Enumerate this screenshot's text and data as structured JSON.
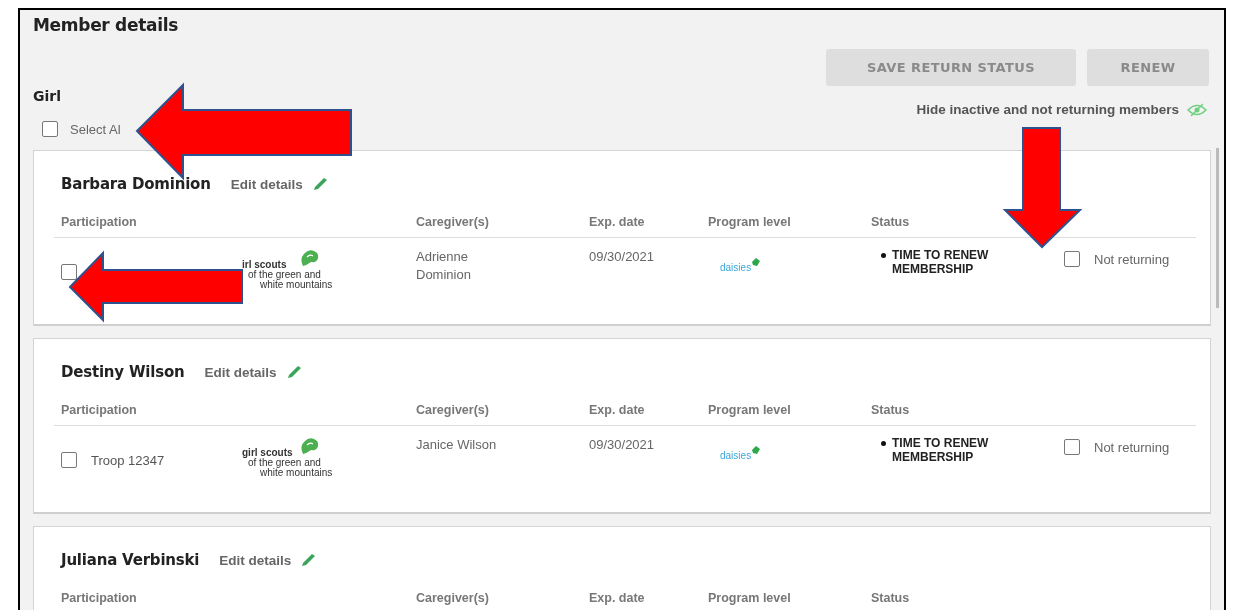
{
  "title": "Member details",
  "buttons": [
    {
      "label": "SAVE RETURN STATUS",
      "disabled": true
    },
    {
      "label": "RENEW",
      "disabled": true
    }
  ],
  "section": "Girl",
  "select_all": {
    "label": "Select Al",
    "checked": false
  },
  "hide_toggle": {
    "label": "Hide inactive and not returning members"
  },
  "members": [
    {
      "name": "Barbara Dominion",
      "edit_label": "Edit details",
      "columns": [
        "Participation",
        "Caregiver(s)",
        "Exp. date",
        "Program level",
        "Status"
      ],
      "row": {
        "troop_checked": false,
        "org_logo": [
          "irl scouts",
          "of the green and",
          "white mountains"
        ],
        "caregiver": "Adrienne Dominion",
        "exp_date": "09/30/2021",
        "program_logo": "daisies",
        "status": "TIME TO RENEW MEMBERSHIP",
        "not_returning": {
          "label": "Not returning",
          "checked": false
        }
      }
    },
    {
      "name": "Destiny Wilson",
      "edit_label": "Edit details",
      "columns": [
        "Participation",
        "Caregiver(s)",
        "Exp. date",
        "Program level",
        "Status"
      ],
      "row": {
        "troop_checked": false,
        "troop": "Troop 12347",
        "org_logo": [
          "girl scouts",
          "of the green and",
          "white mountains"
        ],
        "caregiver": "Janice Wilson",
        "exp_date": "09/30/2021",
        "program_logo": "daisies",
        "status": "TIME TO RENEW MEMBERSHIP",
        "not_returning": {
          "label": "Not returning",
          "checked": false
        }
      }
    },
    {
      "name": "Juliana Verbinski",
      "edit_label": "Edit details",
      "columns": [
        "Participation",
        "Caregiver(s)",
        "Exp. date",
        "Program level",
        "Status"
      ]
    }
  ],
  "annotations": [
    {
      "kind": "arrow"
    },
    {
      "kind": "arrow"
    },
    {
      "kind": "arrow"
    }
  ]
}
